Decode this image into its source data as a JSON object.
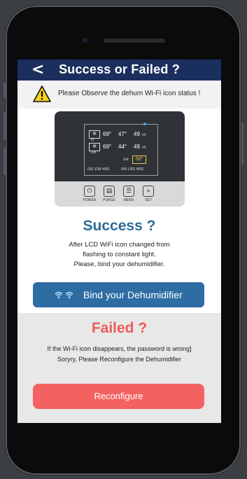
{
  "nav": {
    "back_icon": "chevron-left-icon",
    "back_glyph": "<",
    "title": "Success or Failed ?"
  },
  "warning": {
    "icon": "warning-triangle-icon",
    "text": "Please Observe the dehum Wi-Fi icon status !"
  },
  "device": {
    "lcd": {
      "row1": {
        "temp": "69°",
        "rh": "47°",
        "val": "49",
        "unit": "r/h"
      },
      "row2": {
        "temp": "69°",
        "rh": "44°",
        "val": "49",
        "unit": "r/h"
      },
      "in_label": "In",
      "out_label": "Out",
      "set_label": "Set",
      "set_value": "50°",
      "job_hrs": "000 JOB HRS",
      "life_hrs": "000 LIFE HRS"
    },
    "keys": [
      {
        "icon": "power-icon",
        "glyph": "⏻",
        "label": "POWER"
      },
      {
        "icon": "purge-icon",
        "glyph": "▤",
        "label": "PURGE"
      },
      {
        "icon": "menu-icon",
        "glyph": "☰",
        "label": "MENU"
      },
      {
        "icon": "set-icon",
        "glyph": "»",
        "label": "SET"
      }
    ]
  },
  "success": {
    "title": "Success ?",
    "line1": "After LCD WiFi icon changed from",
    "line2": "flashing to constant light.",
    "line3": "Please, bind your dehumidifier."
  },
  "bind_button": {
    "icon": "wifi-bind-icon",
    "label": "Bind your Dehumidifier"
  },
  "failed": {
    "title": "Failed ?",
    "line1": "If the Wi-Fi icon disappears, the password is wrong]",
    "line2": "Soryry, Please Reconfigure the Dehumidifier"
  },
  "reconfigure_button": {
    "label": "Reconfigure"
  },
  "colors": {
    "nav": "#1b2f5e",
    "success": "#2d6b96",
    "bind": "#2e6da4",
    "failed": "#ee5b5b",
    "reconfigure": "#f46161"
  }
}
